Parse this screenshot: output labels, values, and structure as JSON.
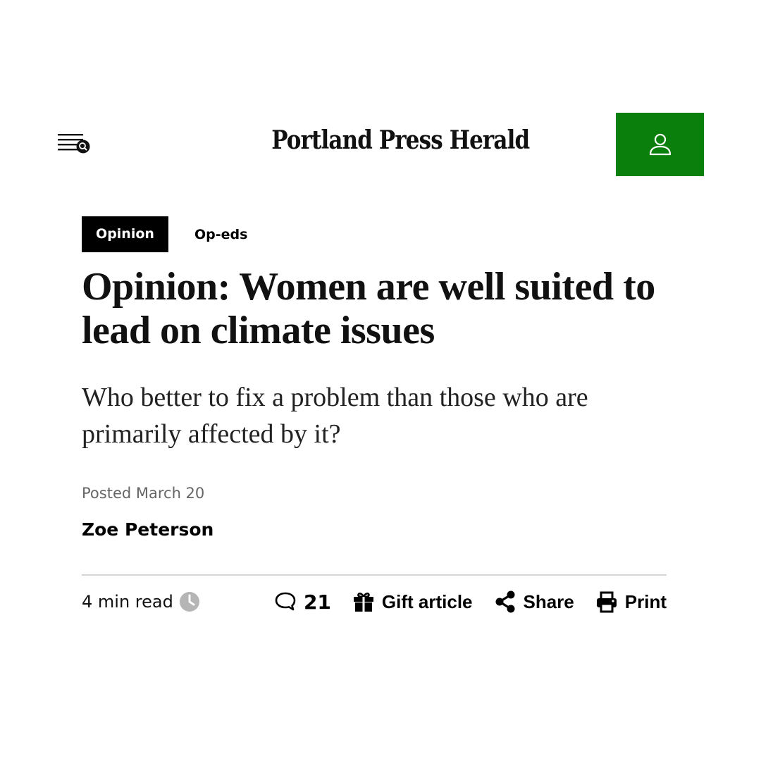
{
  "header": {
    "logo_text": "Portland Press Herald",
    "menu_icon": "menu-search-icon",
    "account_icon": "user-icon",
    "accent_color": "#0b7f0b"
  },
  "article": {
    "section_label": "Opinion",
    "subsection_label": "Op-eds",
    "headline": "Opinion: Women are well suited to lead on climate issues",
    "dek": "Who better to fix a problem than those who are primarily affected by it?",
    "posted": "Posted March 20",
    "author": "Zoe Peterson"
  },
  "toolbar": {
    "read_time": "4 min read",
    "comments_count": "21",
    "gift_label": "Gift article",
    "share_label": "Share",
    "print_label": "Print"
  }
}
